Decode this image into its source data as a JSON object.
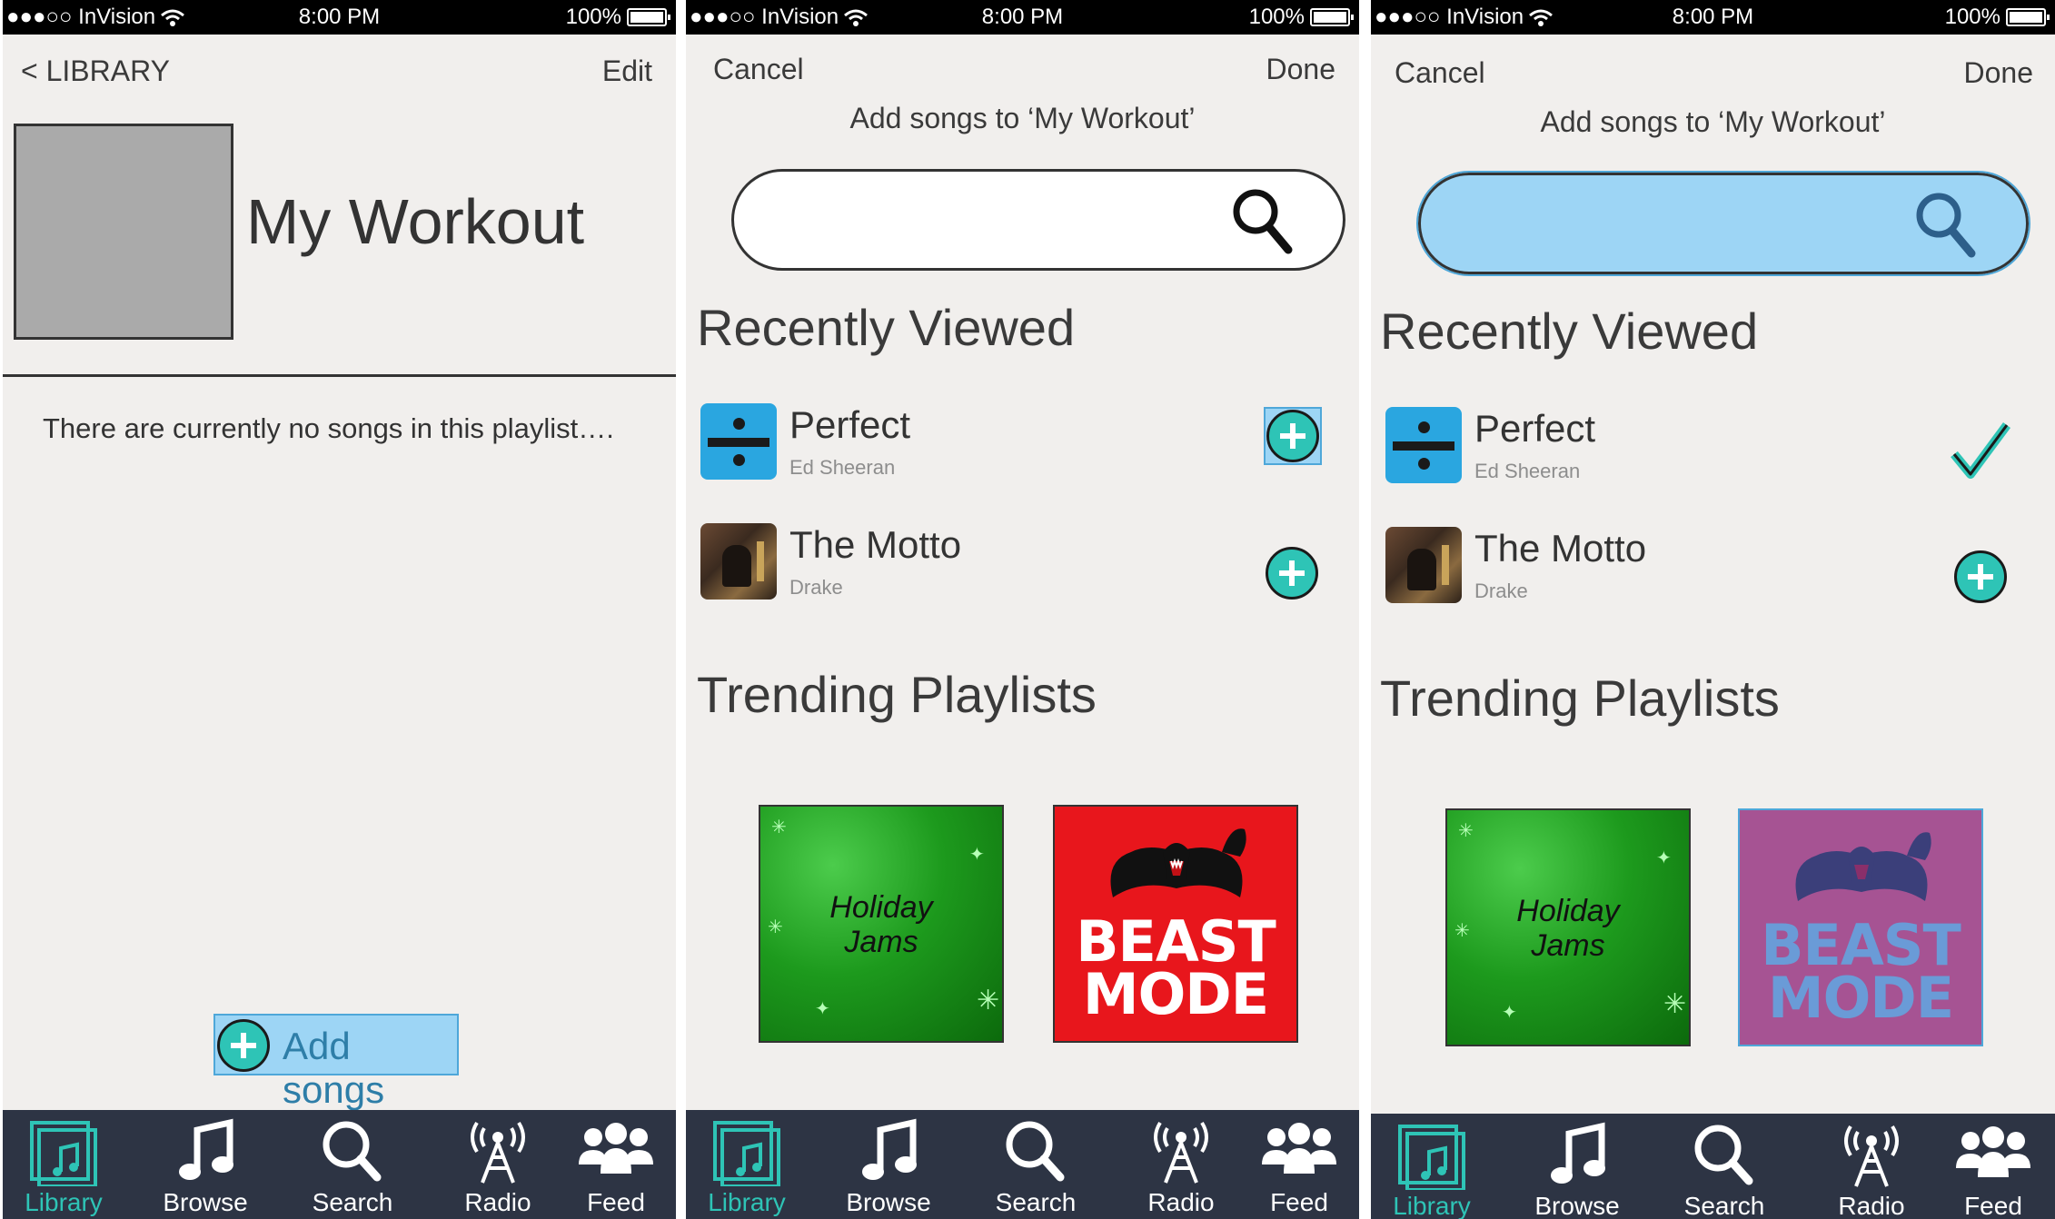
{
  "status_bar": {
    "carrier": "●●●○○ InVision",
    "time": "8:00 PM",
    "battery": "100%"
  },
  "screen1": {
    "back_label": "< LIBRARY",
    "edit_label": "Edit",
    "playlist_title": "My Workout",
    "empty_message": "There are currently no songs in this playlist….",
    "add_songs_label": "Add songs"
  },
  "add_screen": {
    "cancel_label": "Cancel",
    "done_label": "Done",
    "subtitle": "Add songs to ‘My Workout’",
    "recently_viewed_title": "Recently Viewed",
    "trending_title": "Trending Playlists",
    "songs": [
      {
        "title": "Perfect",
        "artist": "Ed Sheeran"
      },
      {
        "title": "The Motto",
        "artist": "Drake"
      }
    ],
    "playlists": [
      {
        "label_line1": "Holiday",
        "label_line2": "Jams"
      },
      {
        "label_line1": "BEAST",
        "label_line2": "MODE"
      }
    ]
  },
  "tabbar": {
    "items": [
      {
        "label": "Library",
        "icon": "music-folder-icon"
      },
      {
        "label": "Browse",
        "icon": "music-note-icon"
      },
      {
        "label": "Search",
        "icon": "search-icon"
      },
      {
        "label": "Radio",
        "icon": "radio-tower-icon"
      },
      {
        "label": "Feed",
        "icon": "people-icon"
      }
    ],
    "active_color": "#2ec4b6",
    "background": "#2d3444"
  },
  "colors": {
    "accent": "#2ec4b6",
    "highlight": "#9dd5f5",
    "beast_red": "#e8161c",
    "beast_purple": "#a65393"
  }
}
